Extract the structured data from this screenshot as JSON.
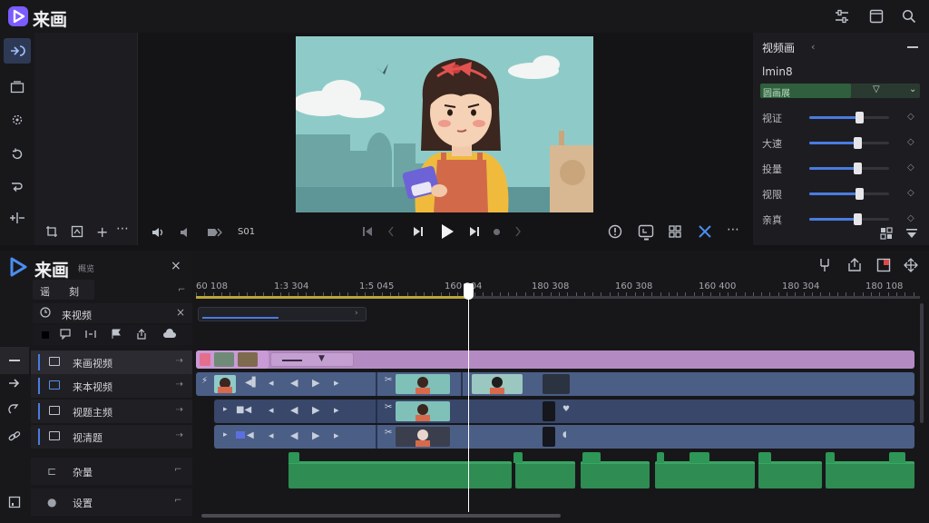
{
  "app": {
    "title": "来画",
    "panel_title": "来画",
    "panel_subtitle": "概览"
  },
  "colors": {
    "accent": "#4a7be0",
    "brand": "#7c5cff",
    "playhead": "#ffffff",
    "track_video": "#4c5f86",
    "track_title": "#b88bc4",
    "track_audio": "#2f8c52"
  },
  "top_icons": [
    "adjust-icon",
    "window-icon",
    "search-icon"
  ],
  "preview_controls": {
    "counter": "S01"
  },
  "inspector": {
    "title": "视频画",
    "preset": "lmin8",
    "dropdown": "圆画展",
    "rows": [
      {
        "label": "视证",
        "value": 0.62
      },
      {
        "label": "大速",
        "value": 0.6
      },
      {
        "label": "投量",
        "value": 0.6
      },
      {
        "label": "视限",
        "value": 0.62
      },
      {
        "label": "亲真",
        "value": 0.6
      }
    ]
  },
  "project": {
    "tabs": [
      "谣",
      "刻"
    ],
    "section": "来视频",
    "tracks": [
      {
        "label": "来画视频"
      },
      {
        "label": "来本视频"
      },
      {
        "label": "视题主频"
      },
      {
        "label": "视清题"
      }
    ],
    "extra": [
      {
        "label": "杂量"
      },
      {
        "label": "设置"
      }
    ]
  },
  "timeline": {
    "ticks": [
      "60 108",
      "1:3 304",
      "1:5 045",
      "160 304",
      "180 308",
      "160 308",
      "160 400",
      "180 304",
      "180 108"
    ],
    "playhead_label": "160 304",
    "marker": "▼"
  }
}
